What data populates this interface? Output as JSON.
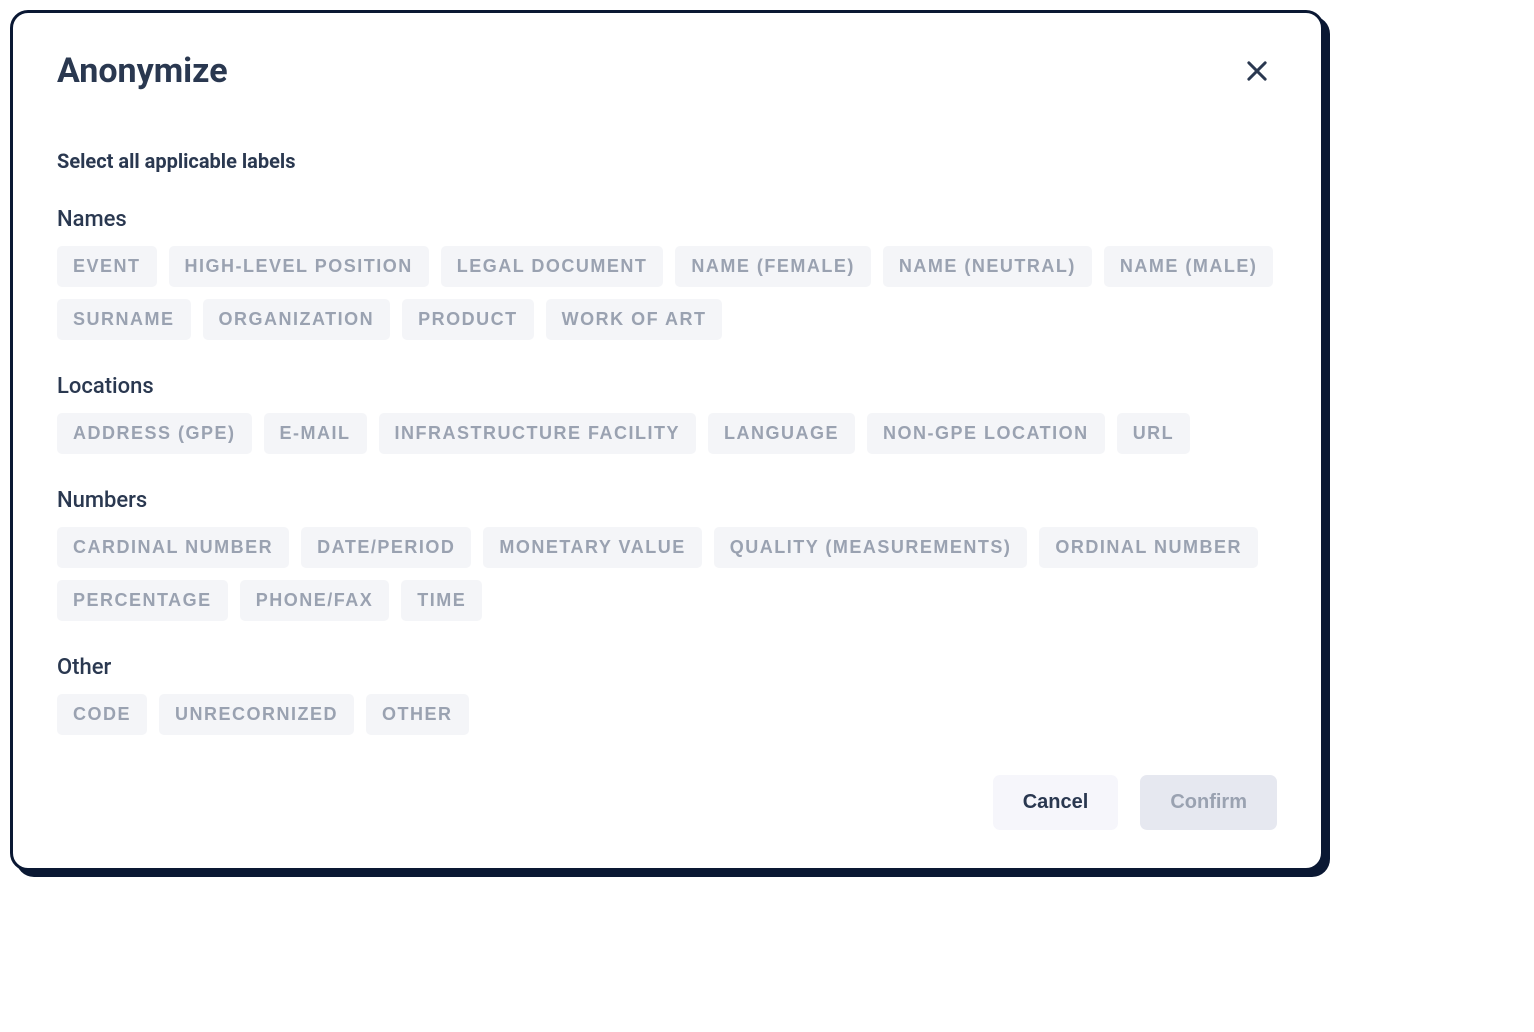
{
  "dialog": {
    "title": "Anonymize",
    "instruction": "Select all applicable labels",
    "groups": [
      {
        "name": "Names",
        "chips": [
          "EVENT",
          "HIGH-LEVEL POSITION",
          "LEGAL DOCUMENT",
          "NAME (FEMALE)",
          "NAME (NEUTRAL)",
          "NAME (MALE)",
          "SURNAME",
          "ORGANIZATION",
          "PRODUCT",
          "WORK OF ART"
        ]
      },
      {
        "name": "Locations",
        "chips": [
          "ADDRESS (GPE)",
          "E-MAIL",
          "INFRASTRUCTURE FACILITY",
          "LANGUAGE",
          "NON-GPE LOCATION",
          "URL"
        ]
      },
      {
        "name": "Numbers",
        "chips": [
          "CARDINAL NUMBER",
          "DATE/PERIOD",
          "MONETARY VALUE",
          "QUALITY (MEASUREMENTS)",
          "ORDINAL NUMBER",
          "PERCENTAGE",
          "PHONE/FAX",
          "TIME"
        ]
      },
      {
        "name": "Other",
        "chips": [
          "CODE",
          "UNRECORNIZED",
          "OTHER"
        ]
      }
    ],
    "buttons": {
      "cancel": "Cancel",
      "confirm": "Confirm"
    }
  }
}
